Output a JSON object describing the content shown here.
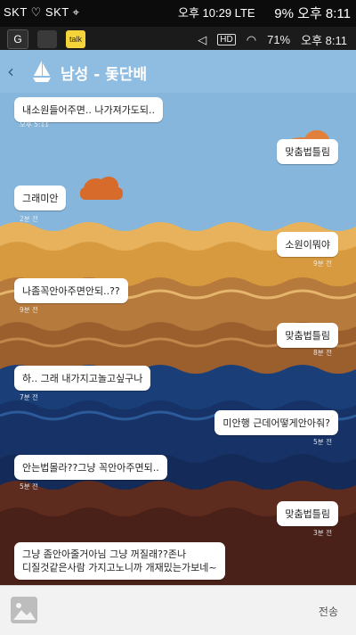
{
  "status_bar": {
    "left": "SKT ♡ SKT  ⌖",
    "center": "오후 10:29 LTE",
    "right": "9%  오후 8:11"
  },
  "system_bar": {
    "battery": "71%",
    "time": "오후 8:11",
    "hd": "HD"
  },
  "chat": {
    "title": "남성 - 돛단배",
    "back": "‹"
  },
  "messages": [
    {
      "text": "내소원들어주면.. 나가져가도되..",
      "time": "오후 5:11"
    },
    {
      "text": "맞춤법틀림",
      "time": ""
    },
    {
      "text": "그래미안",
      "time": "2분 전"
    },
    {
      "text": "소원이뭐야",
      "time": "9분 전"
    },
    {
      "text": "나좀꼭안아주면안되..??",
      "time": "9분 전"
    },
    {
      "text": "맞춤법틀림",
      "time": "8분 전"
    },
    {
      "text": "하.. 그래 내가지고놀고싶구나",
      "time": "7분 전"
    },
    {
      "text": "미안행 근데어떻게안아줘?",
      "time": "5분 전"
    },
    {
      "text": "안는법몰라??그냥 꼭안아주면되..",
      "time": "5분 전"
    },
    {
      "text": "맞춤법틀림",
      "time": "3분 전"
    },
    {
      "text": "그냥 좀안아줄거아님 그냥 꺼질래??존나\n디질것같은사람 가지고노니까 개재밌는가보네~",
      "time": ""
    }
  ],
  "input": {
    "send_label": "전송"
  },
  "colors": {
    "sky": "#86b6db",
    "sun_orange": "#e8892f",
    "wave_tan": "#cda364",
    "wave_brown": "#a86b32",
    "sea_blue": "#1a3f78",
    "deep_brown": "#5e2c1e"
  }
}
